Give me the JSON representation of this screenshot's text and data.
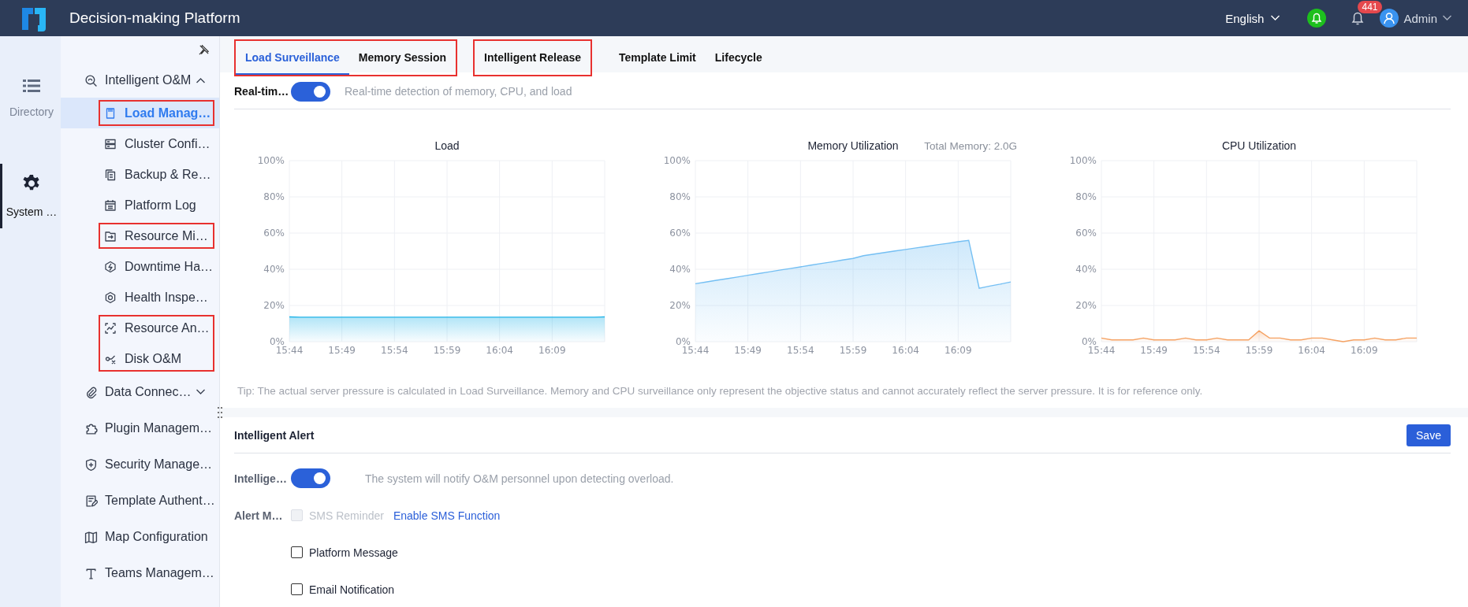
{
  "header": {
    "title": "Decision-making Platform",
    "language": "English",
    "badge_count": "441",
    "user": "Admin"
  },
  "rail": [
    {
      "label": "Directory",
      "selected": false
    },
    {
      "label": "System …",
      "selected": true
    }
  ],
  "sidebar": {
    "groups": [
      {
        "kind": "folder",
        "label": "Intelligent O&M",
        "expanded": true,
        "blocks": [
          {
            "highlighted": true,
            "items": [
              {
                "label": "Load Manag…",
                "selected": true
              }
            ]
          },
          {
            "highlighted": false,
            "items": [
              {
                "label": "Cluster Confi…",
                "selected": false
              },
              {
                "label": "Backup & Re…",
                "selected": false
              },
              {
                "label": "Platform Log",
                "selected": false
              }
            ]
          },
          {
            "highlighted": true,
            "items": [
              {
                "label": "Resource Mi…",
                "selected": false
              }
            ]
          },
          {
            "highlighted": false,
            "items": [
              {
                "label": "Downtime Ha…",
                "selected": false
              },
              {
                "label": "Health Inspe…",
                "selected": false
              }
            ]
          },
          {
            "highlighted": true,
            "items": [
              {
                "label": "Resource An…",
                "selected": false
              },
              {
                "label": "Disk O&M",
                "selected": false
              }
            ]
          }
        ]
      },
      {
        "kind": "folder",
        "label": "Data Connec…",
        "expanded": false
      },
      {
        "kind": "page",
        "label": "Plugin Managem…"
      },
      {
        "kind": "page",
        "label": "Security Manage…"
      },
      {
        "kind": "page",
        "label": "Template Authent…"
      },
      {
        "kind": "page",
        "label": "Map Configuration"
      },
      {
        "kind": "page",
        "label": "Teams Managem…"
      }
    ]
  },
  "tab_groups": [
    {
      "highlighted": true,
      "tabs": [
        {
          "label": "Load Surveillance",
          "selected": true
        },
        {
          "label": "Memory Session",
          "selected": false
        }
      ]
    },
    {
      "highlighted": true,
      "tabs": [
        {
          "label": "Intelligent Release",
          "selected": false
        }
      ]
    },
    {
      "highlighted": false,
      "tabs": [
        {
          "label": "Template Limit",
          "selected": false
        },
        {
          "label": "Lifecycle",
          "selected": false
        }
      ]
    }
  ],
  "realtime": {
    "label": "Real-tim…",
    "on": true,
    "hint": "Real-time detection of memory, CPU, and load"
  },
  "charts": [
    {
      "chart_data": {
        "type": "area",
        "title": "Load",
        "grid": true,
        "categories": [
          "15:44",
          null,
          null,
          null,
          null,
          "15:49",
          null,
          null,
          null,
          null,
          "15:54",
          null,
          null,
          null,
          null,
          "15:59",
          null,
          null,
          null,
          null,
          "16:04",
          null,
          null,
          null,
          null,
          "16:09",
          null,
          null,
          null,
          null,
          null
        ],
        "ylim": [
          0,
          100
        ],
        "yticks": [
          {
            "value": 0,
            "label": "0%"
          },
          {
            "value": 20,
            "label": "20%"
          },
          {
            "value": 40,
            "label": "40%"
          },
          {
            "value": 60,
            "label": "60%"
          },
          {
            "value": 80,
            "label": "80%"
          },
          {
            "value": 100,
            "label": "100%"
          }
        ],
        "series": [
          {
            "color": "#1fb3e8",
            "values": [
              13.7,
              13.5,
              13.5,
              13.5,
              13.5,
              13.5,
              13.5,
              13.5,
              13.5,
              13.5,
              13.5,
              13.5,
              13.5,
              13.5,
              13.5,
              13.5,
              13.5,
              13.5,
              13.5,
              13.5,
              13.5,
              13.5,
              13.5,
              13.5,
              13.5,
              13.5,
              13.5,
              13.5,
              13.5,
              13.5,
              13.7
            ]
          }
        ]
      }
    },
    {
      "note": "Total Memory: 2.0G",
      "chart_data": {
        "type": "area",
        "title": "Memory Utilization",
        "grid": true,
        "categories": [
          "15:44",
          null,
          null,
          null,
          null,
          "15:49",
          null,
          null,
          null,
          null,
          "15:54",
          null,
          null,
          null,
          null,
          "15:59",
          null,
          null,
          null,
          null,
          "16:04",
          null,
          null,
          null,
          null,
          "16:09",
          null,
          null,
          null,
          null,
          null
        ],
        "ylim": [
          0,
          100
        ],
        "yticks": [
          {
            "value": 0,
            "label": "0%"
          },
          {
            "value": 20,
            "label": "20%"
          },
          {
            "value": 40,
            "label": "40%"
          },
          {
            "value": 60,
            "label": "60%"
          },
          {
            "value": 80,
            "label": "80%"
          },
          {
            "value": 100,
            "label": "100%"
          }
        ],
        "series": [
          {
            "color": "#74bff3",
            "values": [
              32,
              32.9,
              33.9,
              34.8,
              35.7,
              36.7,
              37.6,
              38.5,
              39.5,
              40.4,
              41.3,
              42.3,
              43.2,
              44.1,
              45.1,
              46,
              47.5,
              48.4,
              49.2,
              50.1,
              50.9,
              51.8,
              52.6,
              53.5,
              54.3,
              55.2,
              56,
              29.5,
              30.7,
              31.8,
              33
            ]
          }
        ]
      }
    },
    {
      "chart_data": {
        "type": "area",
        "title": "CPU Utilization",
        "grid": true,
        "categories": [
          "15:44",
          null,
          null,
          null,
          null,
          "15:49",
          null,
          null,
          null,
          null,
          "15:54",
          null,
          null,
          null,
          null,
          "15:59",
          null,
          null,
          null,
          null,
          "16:04",
          null,
          null,
          null,
          null,
          "16:09",
          null,
          null,
          null,
          null,
          null
        ],
        "ylim": [
          0,
          100
        ],
        "yticks": [
          {
            "value": 0,
            "label": "0%"
          },
          {
            "value": 20,
            "label": "20%"
          },
          {
            "value": 40,
            "label": "40%"
          },
          {
            "value": 60,
            "label": "60%"
          },
          {
            "value": 80,
            "label": "80%"
          },
          {
            "value": 100,
            "label": "100%"
          }
        ],
        "series": [
          {
            "color": "#f5a263",
            "values": [
              2,
              1,
              1,
              1,
              2,
              1,
              1,
              1,
              2,
              1,
              1,
              2,
              1,
              1,
              1,
              6,
              2,
              2,
              1,
              1,
              2,
              2,
              1,
              0,
              1,
              1,
              2,
              1,
              1,
              2,
              2
            ]
          }
        ]
      }
    }
  ],
  "tip": "Tip: The actual server pressure is calculated in Load Surveillance. Memory and CPU surveillance only represent the objective status and cannot accurately reflect the server pressure. It is for reference only.",
  "alert": {
    "title": "Intelligent Alert",
    "save": "Save",
    "toggle_label": "Intellige…",
    "on": true,
    "hint": "The system will notify O&M personnel upon detecting overload.",
    "method_label": "Alert M…",
    "methods": [
      {
        "label": "SMS Reminder",
        "checked": false,
        "disabled": true,
        "link": "Enable SMS Function"
      },
      {
        "label": "Platform Message",
        "checked": false,
        "disabled": false
      },
      {
        "label": "Email Notification",
        "checked": false,
        "disabled": false
      }
    ]
  }
}
